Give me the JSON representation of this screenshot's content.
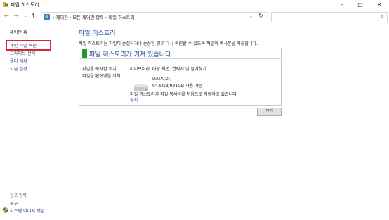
{
  "window": {
    "title": "파일 히스토리",
    "minimize": "–",
    "maximize": "□",
    "close": "✕"
  },
  "nav": {
    "back": "←",
    "forward": "→",
    "recent": "⌄",
    "up": "↑"
  },
  "address": {
    "crumbs": "› 제어판 › 모든 제어판 항목 › 파일 히스토리",
    "dropdown": "⌄",
    "refresh": "↻"
  },
  "search": {
    "icon": "⌕"
  },
  "sidebar": {
    "items": [
      {
        "label": "제어판 홈"
      },
      {
        "label": "개인 파일 복원"
      },
      {
        "label": "드라이브 선택"
      },
      {
        "label": "폴더 제외"
      },
      {
        "label": "고급 설정"
      }
    ],
    "see_also": {
      "heading": "참고 항목",
      "items": [
        {
          "label": "복구"
        },
        {
          "label": "시스템 이미지 백업"
        }
      ]
    },
    "highlight_color": "#e0202b"
  },
  "main": {
    "heading": "파일 히스토리",
    "description": "파일 히스토리는 파일이 손실되거나 손상된 경우 다시 복원할 수 있도록 파일의 복사본을 저장합니다.",
    "panel": {
      "title": "파일 히스토리가 켜져 있습니다.",
      "status_color": "#1c9a2c",
      "copy_from_label": "파일을 복사할 위치:",
      "copy_from_value": "라이브러리, 바탕 화면, 연락처 및 즐겨찾기",
      "copy_to_label": "파일을 붙여넣을 위치:",
      "drive_name": "DATA(D:)",
      "drive_size": "94.8GB/931GB 사용 가능",
      "status_text": "파일 히스토리가 파일 복사본을 처음으로 저장하고 있습니다.",
      "stop_link": "중지"
    },
    "off_button": "끄기"
  }
}
